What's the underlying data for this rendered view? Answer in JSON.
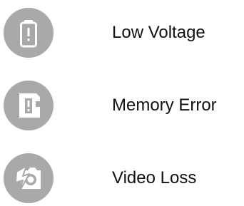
{
  "items": [
    {
      "icon": "battery-alert-icon",
      "label": "Low Voltage"
    },
    {
      "icon": "memory-card-error-icon",
      "label": "Memory Error"
    },
    {
      "icon": "camera-off-icon",
      "label": "Video Loss"
    }
  ],
  "colors": {
    "badge": "#a9a9a9",
    "glyph": "#ffffff",
    "text": "#111111"
  }
}
